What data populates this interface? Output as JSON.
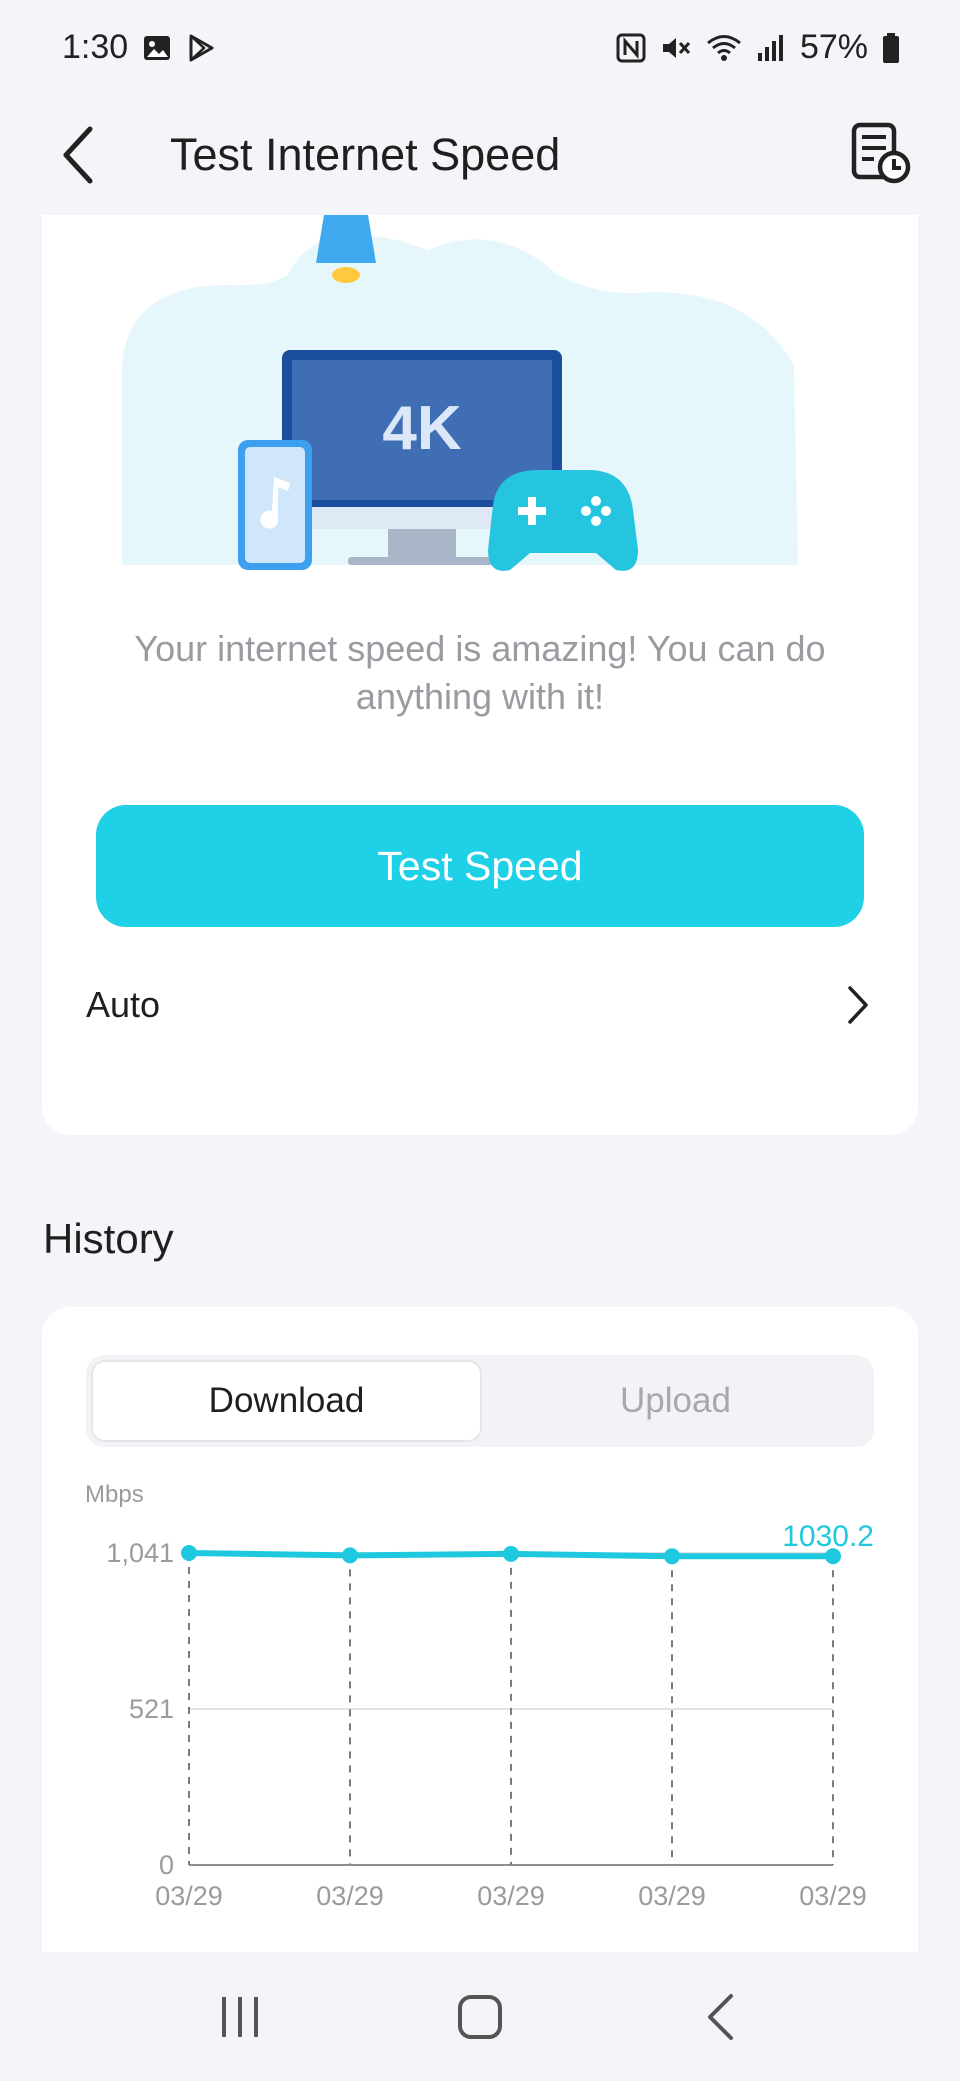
{
  "status_bar": {
    "time": "1:30",
    "battery": "57%",
    "icons": [
      "image-icon",
      "play-store-icon",
      "nfc-icon",
      "mute-icon",
      "wifi-icon",
      "signal-icon",
      "battery-icon"
    ]
  },
  "header": {
    "title": "Test Internet Speed",
    "back_icon": "back-arrow-icon",
    "report_icon": "report-history-icon"
  },
  "hero": {
    "screen_text": "4K",
    "message": "Your internet speed is amazing! You can do anything with it!"
  },
  "test_button": {
    "label": "Test Speed"
  },
  "auto_row": {
    "label": "Auto"
  },
  "history": {
    "title": "History",
    "tabs": [
      {
        "label": "Download",
        "active": true
      },
      {
        "label": "Upload",
        "active": false
      }
    ],
    "chart_data": {
      "type": "line",
      "ylabel": "Mbps",
      "yticks": [
        "0",
        "521",
        "1,041"
      ],
      "ylim": [
        0,
        1041
      ],
      "categories": [
        "03/29",
        "03/29",
        "03/29",
        "03/29",
        "03/29"
      ],
      "values": [
        1041,
        1033,
        1038,
        1030,
        1030.2
      ],
      "last_value_label": "1030.2",
      "color": "#1ec8df"
    }
  },
  "colors": {
    "accent": "#1ed1e6",
    "background": "#f4f5f9",
    "card": "#ffffff"
  }
}
